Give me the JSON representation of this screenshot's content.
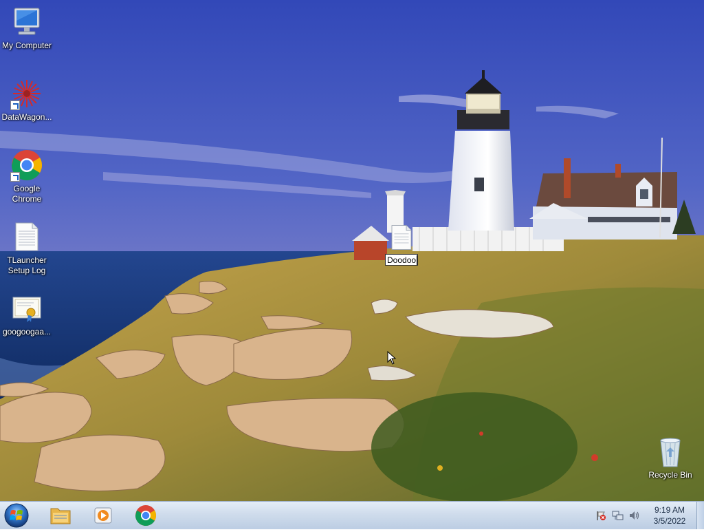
{
  "desktop": {
    "icons": [
      {
        "label": "My Computer",
        "icon": "computer-icon"
      },
      {
        "label": "DataWagon...",
        "icon": "datawagon-icon"
      },
      {
        "label": "Google Chrome",
        "icon": "chrome-icon"
      },
      {
        "label": "TLauncher Setup Log",
        "icon": "text-file-icon"
      },
      {
        "label": "googoogaa...",
        "icon": "certificate-icon"
      },
      {
        "label": "Recycle Bin",
        "icon": "recycle-bin-icon"
      }
    ],
    "renaming_file": {
      "value": "Doodoo",
      "icon": "text-file-icon"
    }
  },
  "taskbar": {
    "start_icon": "windows-start-icon",
    "pinned": [
      "file-explorer-icon",
      "media-player-icon",
      "chrome-icon"
    ],
    "tray_icons": [
      "action-center-flag-icon",
      "network-icon",
      "volume-icon"
    ],
    "clock": {
      "time": "9:19 AM",
      "date": "3/5/2022"
    }
  },
  "colors": {
    "taskbar": "#cfdcec",
    "sky": "#4a63c8",
    "accent": "#1a5fc0"
  }
}
